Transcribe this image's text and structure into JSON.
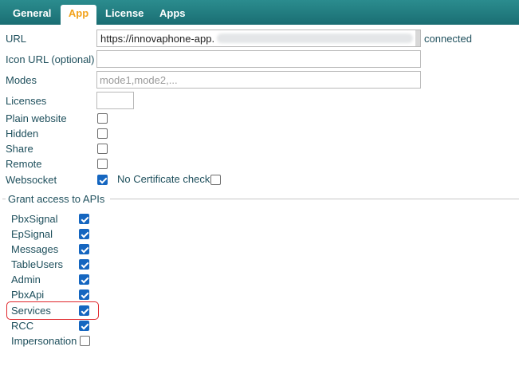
{
  "tabs": [
    {
      "label": "General",
      "active": false
    },
    {
      "label": "App",
      "active": true
    },
    {
      "label": "License",
      "active": false
    },
    {
      "label": "Apps",
      "active": false
    }
  ],
  "form": {
    "url": {
      "label": "URL",
      "value": "https://innovaphone-app.",
      "status": "connected"
    },
    "icon_url": {
      "label": "Icon URL (optional)",
      "value": ""
    },
    "modes": {
      "label": "Modes",
      "value": "",
      "placeholder": "mode1,mode2,..."
    },
    "licenses": {
      "label": "Licenses",
      "value": ""
    },
    "plain_website": {
      "label": "Plain website",
      "checked": false
    },
    "hidden": {
      "label": "Hidden",
      "checked": false
    },
    "share": {
      "label": "Share",
      "checked": false
    },
    "remote": {
      "label": "Remote",
      "checked": false
    },
    "websocket": {
      "label": "Websocket",
      "checked": true
    },
    "no_certificate_check": {
      "label": "No Certificate check",
      "checked": false
    }
  },
  "apis": {
    "legend": "Grant access to APIs",
    "items": [
      {
        "label": "PbxSignal",
        "checked": true
      },
      {
        "label": "EpSignal",
        "checked": true
      },
      {
        "label": "Messages",
        "checked": true
      },
      {
        "label": "TableUsers",
        "checked": true
      },
      {
        "label": "Admin",
        "checked": true
      },
      {
        "label": "PbxApi",
        "checked": true
      },
      {
        "label": "Services",
        "checked": true,
        "highlighted": true
      },
      {
        "label": "RCC",
        "checked": true
      },
      {
        "label": "Impersonation",
        "checked": false
      }
    ]
  },
  "colors": {
    "tabbar": "#1f7a7e",
    "active_tab_text": "#f2a21b",
    "label_text": "#1e4f5c",
    "checkbox_checked": "#1566c0",
    "highlight": "#e0262b"
  }
}
